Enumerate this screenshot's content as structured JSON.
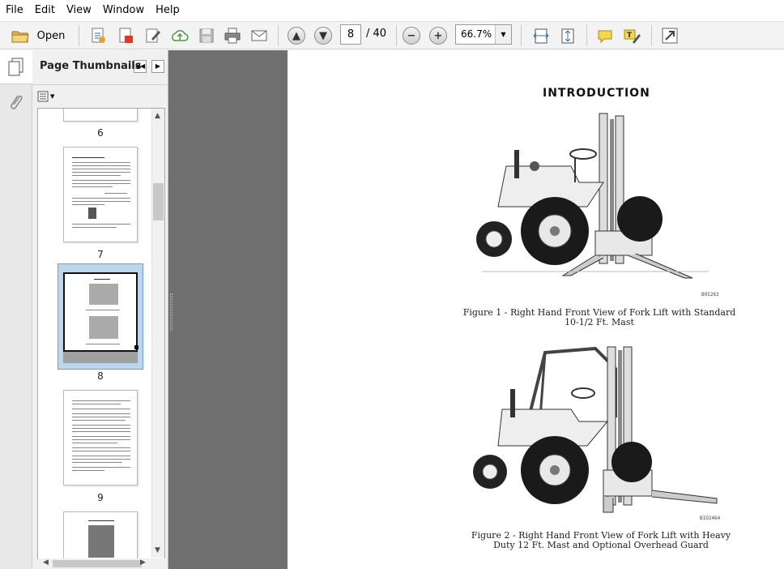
{
  "menu": [
    "File",
    "Edit",
    "View",
    "Window",
    "Help"
  ],
  "toolbar": {
    "open_label": "Open",
    "page_current": "8",
    "page_total": "/ 40",
    "zoom": "66.7%"
  },
  "sidebar": {
    "title": "Page Thumbnails",
    "thumbnails": [
      {
        "label": "6"
      },
      {
        "label": "7"
      },
      {
        "label": "8",
        "selected": true
      },
      {
        "label": "9"
      }
    ]
  },
  "document": {
    "title": "INTRODUCTION",
    "figure1_code": "B9I263",
    "figure1_caption_line1": "Figure 1 - Right Hand Front View of Fork Lift with Standard",
    "figure1_caption_line2": "10-1/2 Ft. Mast",
    "figure2_code": "BIO2464",
    "figure2_caption_line1": "Figure 2 - Right Hand Front View of Fork Lift with Heavy",
    "figure2_caption_line2": "Duty 12 Ft. Mast and Optional Overhead Guard"
  },
  "icons": [
    "open-folder-icon",
    "create-pdf-icon",
    "convert-icon",
    "edit-icon",
    "upload-cloud-icon",
    "save-icon",
    "print-icon",
    "email-icon",
    "previous-page-icon",
    "next-page-icon",
    "zoom-out-icon",
    "zoom-in-icon",
    "fit-width-icon",
    "full-page-icon",
    "comment-icon",
    "highlight-icon",
    "expand-icon"
  ]
}
